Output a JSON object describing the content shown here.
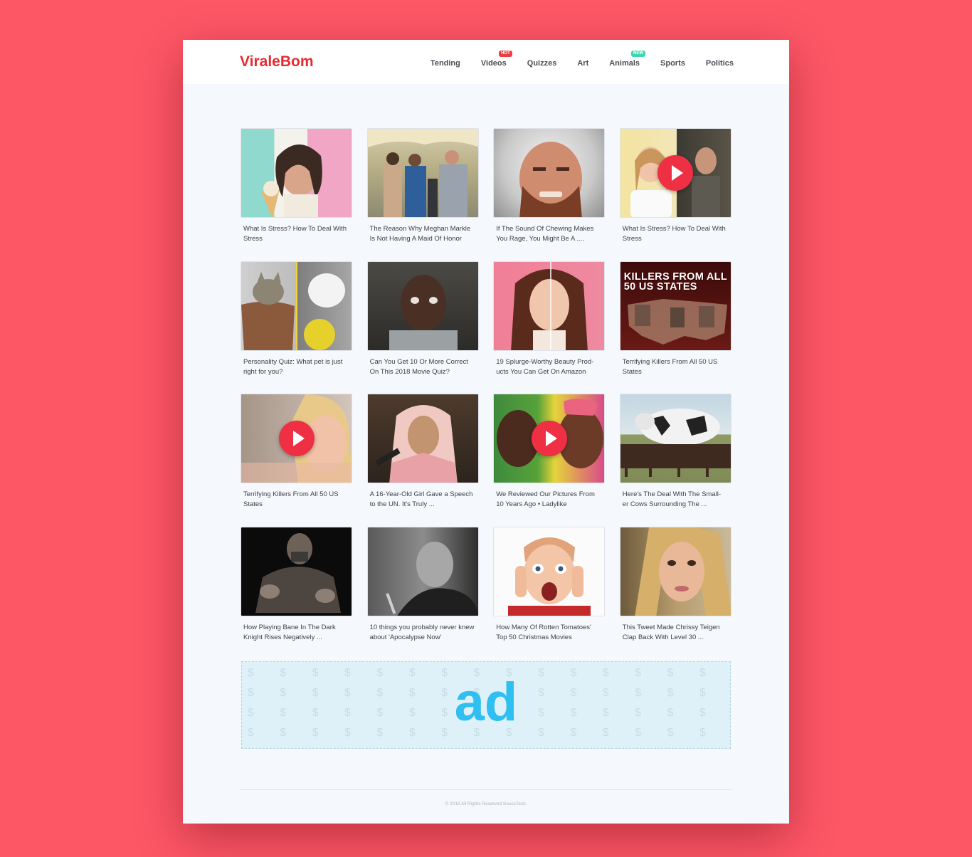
{
  "site": {
    "logo": "ViraleBom"
  },
  "nav": {
    "items": [
      {
        "label": "Tending",
        "badge": null
      },
      {
        "label": "Videos",
        "badge": "HOT",
        "badge_color": "#ee3e45"
      },
      {
        "label": "Quizzes",
        "badge": null
      },
      {
        "label": "Art",
        "badge": null
      },
      {
        "label": "Animals",
        "badge": "NEW",
        "badge_color": "#3ed6b0"
      },
      {
        "label": "Sports",
        "badge": null
      },
      {
        "label": "Politics",
        "badge": null
      }
    ]
  },
  "articles": [
    {
      "title": "What Is Stress? How To Deal With Stress",
      "video": false,
      "image": "woman-smiling-pastel-background"
    },
    {
      "title": "The Reason Why Meghan Markle Is Not Having A Maid Of  Honor",
      "video": false,
      "image": "royal-couple-event"
    },
    {
      "title": "If  The Sound Of  Chewing Makes You Rage, You Might Be A ....",
      "video": false,
      "image": "angry-bearded-man"
    },
    {
      "title": "What Is Stress? How To Deal With Stress",
      "video": true,
      "image": "woman-and-man-split"
    },
    {
      "title": "Personality Quiz: What pet is just right for you?",
      "video": false,
      "image": "kitten-and-bulldog"
    },
    {
      "title": "Can You Get 10 Or More Correct On This 2018 Movie Quiz?",
      "video": false,
      "image": "man-tearful-movie-still"
    },
    {
      "title": "19 Splurge-Worthy Beauty Prod- ucts You Can Get On Amazon",
      "video": false,
      "image": "woman-hair-split"
    },
    {
      "title": "Terrifying Killers From All 50 US States",
      "video": false,
      "image": "us-map-killers",
      "overlay": "KILLERS FROM ALL 50 US STATES"
    },
    {
      "title": "Terrifying Killers From All 50 US States",
      "video": true,
      "image": "blonde-woman-closeup"
    },
    {
      "title": "A 16-Year-Old Girl Gave a Speech to the UN. It's Truly ...",
      "video": false,
      "image": "girl-headscarf-speech"
    },
    {
      "title": "We Reviewed Our Pictures From 10 Years Ago • Ladylike",
      "video": true,
      "image": "two-women-lockers"
    },
    {
      "title": "Here's The Deal With The Small- er Cows Surrounding The ...",
      "video": false,
      "image": "giant-cow-herd"
    },
    {
      "title": "How Playing Bane In The Dark Knight Rises Negatively ...",
      "video": false,
      "image": "bane-masked-man"
    },
    {
      "title": "10 things you probably never knew about 'Apocalypse Now'",
      "video": false,
      "image": "bald-man-black-white"
    },
    {
      "title": "How Many Of  Rotten Tomatoes' Top 50 Christmas Movies",
      "video": false,
      "image": "boy-screaming-hands-face"
    },
    {
      "title": "This Tweet Made Chrissy Teigen Clap Back With Level 30 ...",
      "video": false,
      "image": "woman-selfie-closeup"
    }
  ],
  "ad": {
    "label": "ad",
    "pattern_glyph": "$"
  },
  "footer": {
    "text": "© 2018 All Rights Reserved SoussTech."
  }
}
